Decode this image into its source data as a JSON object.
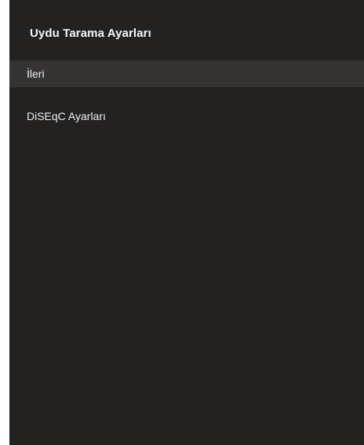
{
  "panel": {
    "title": "Uydu Tarama Ayarları",
    "items": [
      {
        "label": "İleri",
        "selected": true
      },
      {
        "label": "DiSEqC Ayarları",
        "selected": false
      }
    ]
  },
  "colors": {
    "panel_background": "#242121",
    "selected_background": "#363333",
    "text": "#eeeeee"
  }
}
